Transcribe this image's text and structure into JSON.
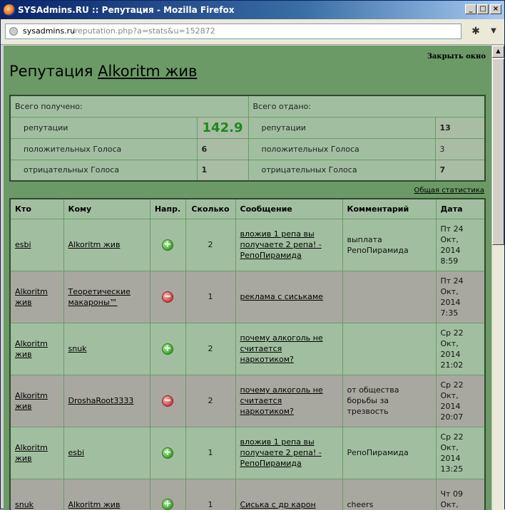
{
  "window": {
    "title": "SYSAdmins.RU :: Репутация - Mozilla Firefox",
    "minimize": "_",
    "maximize": "□",
    "close": "×"
  },
  "urlbar": {
    "host": "sysadmins.ru",
    "path": "/reputation.php?a=stats&u=152872"
  },
  "page": {
    "close_link": "Закрыть окно",
    "title_prefix": "Репутация",
    "user": "Alkoritm жив",
    "stats_link": "Общая статистика"
  },
  "summary": {
    "received_header": "Всего получено:",
    "given_header": "Всего отдано:",
    "rep_label": "репутации",
    "pos_label": "положительных Голоса",
    "neg_label": "отрицательных Голоса",
    "received": {
      "rep": "142.9",
      "pos": "6",
      "neg": "1"
    },
    "given": {
      "rep": "13",
      "pos": "3",
      "neg": "7"
    }
  },
  "log": {
    "headers": [
      "Кто",
      "Кому",
      "Напр.",
      "Сколько",
      "Сообщение",
      "Комментарий",
      "Дата"
    ],
    "rows": [
      {
        "who": "esbi",
        "whom": "Alkoritm жив",
        "dir": "plus",
        "amount": "2",
        "message": "вложив 1 репа вы получаете 2 репа! - РепоПирамида",
        "comment": "выплата РепоПирамида",
        "date": "Пт 24 Окт, 2014 8:59"
      },
      {
        "who": "Alkoritm жив",
        "whom": "Теоретические макароны™",
        "dir": "minus",
        "amount": "1",
        "message": "реклама с сиськаме",
        "comment": "",
        "date": "Пт 24 Окт, 2014 7:35"
      },
      {
        "who": "Alkoritm жив",
        "whom": "snuk",
        "dir": "plus",
        "amount": "2",
        "message": "почему алкоголь не считается наркотиком?",
        "comment": "",
        "date": "Ср 22 Окт, 2014 21:02"
      },
      {
        "who": "Alkoritm жив",
        "whom": "DroshaRoot3333",
        "dir": "minus",
        "amount": "2",
        "message": "почему алкоголь не считается наркотиком?",
        "comment": "от общества борьбы за трезвость",
        "date": "Ср 22 Окт, 2014 20:07"
      },
      {
        "who": "Alkoritm жив",
        "whom": "esbi",
        "dir": "plus",
        "amount": "1",
        "message": "вложив 1 репа вы получаете 2 репа! - РепоПирамида",
        "comment": "РепоПирамида",
        "date": "Ср 22 Окт, 2014 13:25"
      },
      {
        "who": "snuk",
        "whom": "Alkoritm жив",
        "dir": "plus",
        "amount": "1",
        "message": "Сиська с др карон",
        "comment": "cheers",
        "date": "Чт 09 Окт, 2014"
      }
    ]
  },
  "icons": {
    "plus": "+",
    "minus": "−"
  }
}
